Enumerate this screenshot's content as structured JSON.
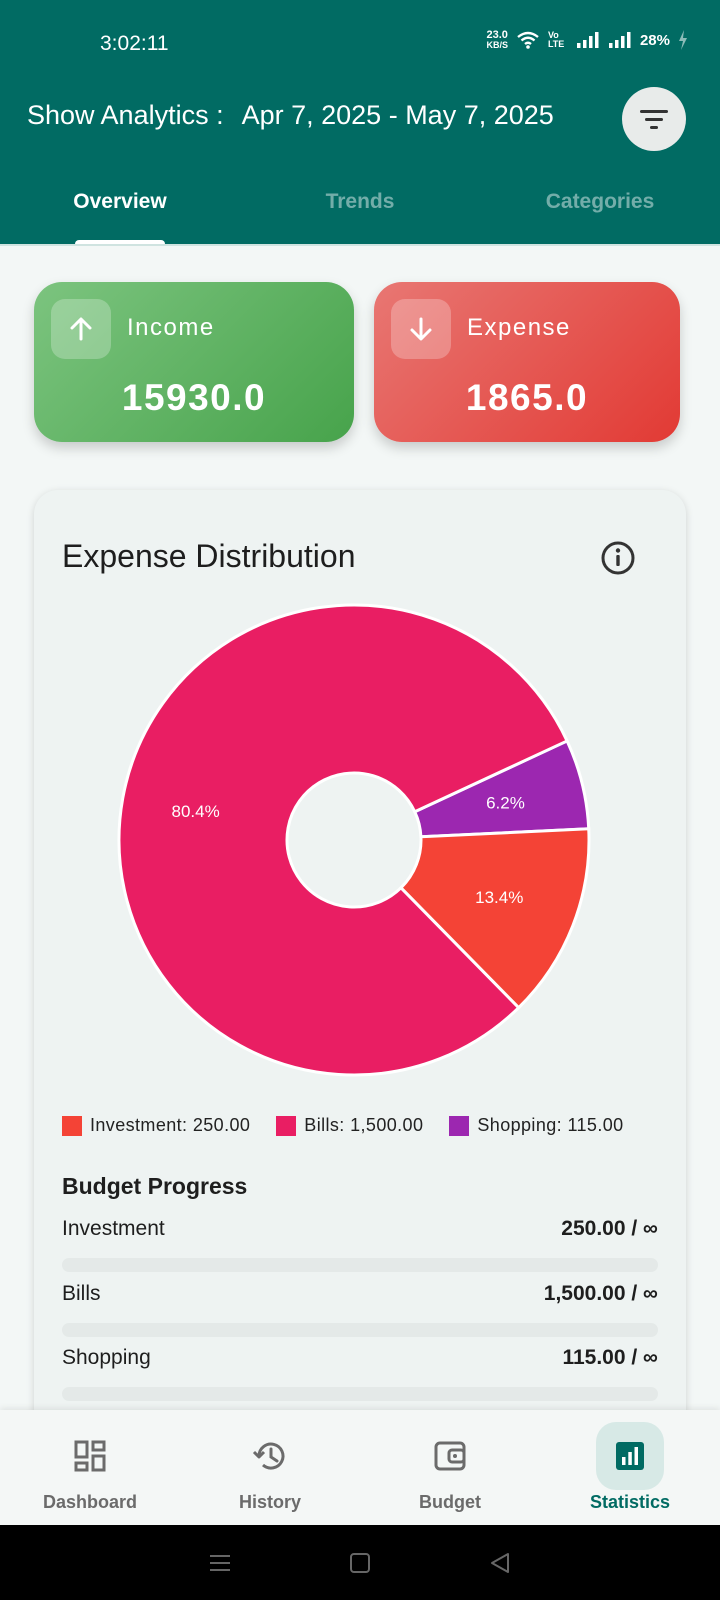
{
  "status_bar": {
    "time": "3:02:11",
    "net_speed_value": "23.0",
    "net_speed_unit": "KB/S",
    "volte_label": "Vo LTE",
    "battery": "28%"
  },
  "header": {
    "title": "Show Analytics :",
    "date_range": "Apr 7, 2025 - May 7, 2025",
    "filter_icon": "filter-icon"
  },
  "tabs": [
    {
      "label": "Overview",
      "active": true
    },
    {
      "label": "Trends",
      "active": false
    },
    {
      "label": "Categories",
      "active": false
    }
  ],
  "summary": {
    "income": {
      "label": "Income",
      "value": "15930.0",
      "icon": "arrow-up-icon"
    },
    "expense": {
      "label": "Expense",
      "value": "1865.0",
      "icon": "arrow-down-icon"
    }
  },
  "distribution": {
    "title": "Expense Distribution",
    "info_icon": "info-icon"
  },
  "chart_data": {
    "type": "pie",
    "donut": true,
    "title": "Expense Distribution",
    "slices": [
      {
        "name": "Shopping",
        "value": 115.0,
        "percent_label": "6.2%",
        "color": "#9c27b0"
      },
      {
        "name": "Investment",
        "value": 250.0,
        "percent_label": "13.4%",
        "color": "#f44336"
      },
      {
        "name": "Bills",
        "value": 1500.0,
        "percent_label": "80.4%",
        "color": "#e91e63"
      }
    ],
    "legend": [
      {
        "label": "Investment: 250.00",
        "color": "#f44336"
      },
      {
        "label": "Bills: 1,500.00",
        "color": "#e91e63"
      },
      {
        "label": "Shopping: 115.00",
        "color": "#9c27b0"
      }
    ],
    "legend_position": "bottom"
  },
  "budget": {
    "title": "Budget Progress",
    "items": [
      {
        "label": "Investment",
        "value": "250.00 / ∞",
        "progress": 0
      },
      {
        "label": "Bills",
        "value": "1,500.00 / ∞",
        "progress": 0
      },
      {
        "label": "Shopping",
        "value": "115.00 / ∞",
        "progress": 0
      }
    ]
  },
  "bottom_nav": [
    {
      "label": "Dashboard",
      "icon": "dashboard-icon",
      "active": false
    },
    {
      "label": "History",
      "icon": "history-icon",
      "active": false
    },
    {
      "label": "Budget",
      "icon": "wallet-icon",
      "active": false
    },
    {
      "label": "Statistics",
      "icon": "bar-chart-icon",
      "active": true
    }
  ],
  "colors": {
    "primary": "#016b63",
    "income_green": "#4caf50",
    "expense_red": "#e53935"
  }
}
